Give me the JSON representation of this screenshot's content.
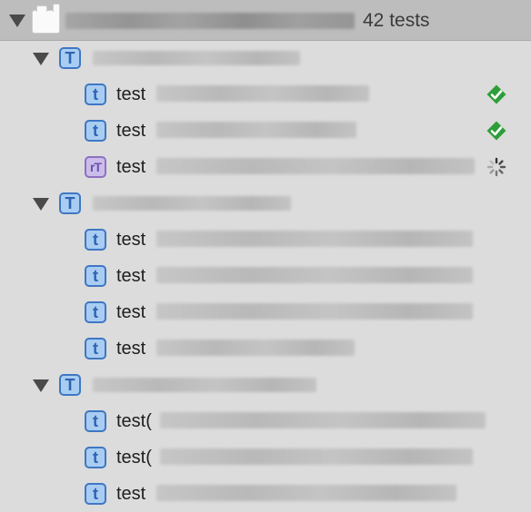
{
  "navigator": {
    "bundle": {
      "count_label": "42 tests"
    },
    "groups": [
      {
        "icon_glyph": "T",
        "tests": [
          {
            "label": "test",
            "icon_glyph": "t",
            "kind": "unit",
            "status": "passed",
            "status_icon": "checkmark-icon"
          },
          {
            "label": "test",
            "icon_glyph": "t",
            "kind": "unit",
            "status": "passed",
            "status_icon": "checkmark-icon"
          },
          {
            "label": "test",
            "icon_glyph": "rT",
            "kind": "performance",
            "status": "running",
            "status_icon": "spinner-icon"
          }
        ]
      },
      {
        "icon_glyph": "T",
        "tests": [
          {
            "label": "test",
            "icon_glyph": "t",
            "kind": "unit"
          },
          {
            "label": "test",
            "icon_glyph": "t",
            "kind": "unit"
          },
          {
            "label": "test",
            "icon_glyph": "t",
            "kind": "unit"
          },
          {
            "label": "test",
            "icon_glyph": "t",
            "kind": "unit"
          }
        ]
      },
      {
        "icon_glyph": "T",
        "tests": [
          {
            "label": "test(",
            "icon_glyph": "t",
            "kind": "unit"
          },
          {
            "label": "test(",
            "icon_glyph": "t",
            "kind": "unit"
          },
          {
            "label": "test",
            "icon_glyph": "t",
            "kind": "unit"
          }
        ]
      }
    ]
  },
  "colors": {
    "background": "#dcdcdc",
    "header_background": "#bdbdbd",
    "test_icon_blue": "#3f77c4",
    "perf_icon_purple": "#8e70c2",
    "pass_green": "#2e9e3a"
  }
}
